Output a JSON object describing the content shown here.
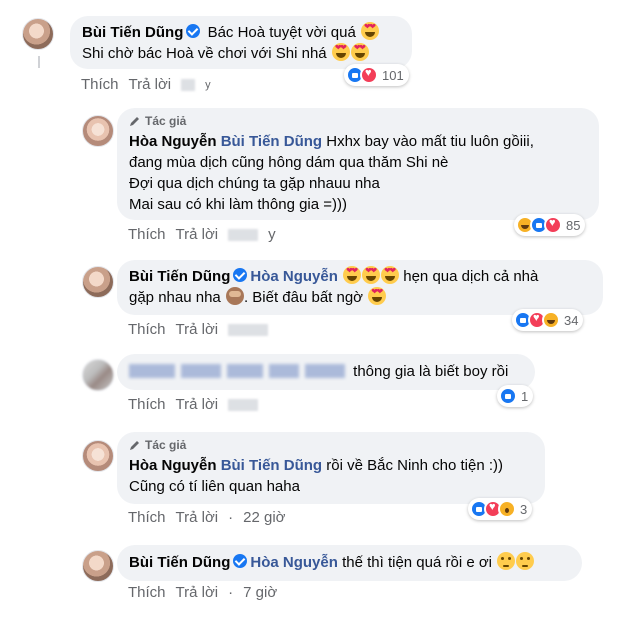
{
  "comments": [
    {
      "author": "Bùi Tiến Dũng",
      "lines": [
        "Bác Hoà tuyệt vời quá",
        "Shi chờ bác Hoà về chơi với Shi nhá"
      ],
      "actions": {
        "like": "Thích",
        "reply": "Trả lời",
        "time": "y"
      },
      "reactions": {
        "icons": [
          "like",
          "love"
        ],
        "count": "101"
      }
    },
    {
      "author_tag": "Tác giả",
      "author": "Hòa Nguyễn",
      "mention": "Bùi Tiến Dũng",
      "lines": [
        "Hxhx bay vào mất tiu luôn gồiii,",
        "đang mùa dịch cũng hông dám qua thăm Shi nè",
        "Đợi qua dịch chúng ta gặp nhauu nha",
        "Mai sau có khi làm thông gia =)))"
      ],
      "actions": {
        "like": "Thích",
        "reply": "Trả lời",
        "time": "y"
      },
      "reactions": {
        "icons": [
          "haha",
          "like",
          "love"
        ],
        "count": "85"
      }
    },
    {
      "author": "Bùi Tiến Dũng",
      "mention": "Hòa Nguyễn",
      "lines": [
        "hẹn qua dịch cả nhà",
        "gặp nhau nha",
        ". Biết đâu bất ngờ"
      ],
      "actions": {
        "like": "Thích",
        "reply": "Trả lời"
      },
      "reactions": {
        "icons": [
          "like",
          "love",
          "haha"
        ],
        "count": "34"
      }
    },
    {
      "text": "thông gia là biết boy rồi",
      "actions": {
        "like": "Thích",
        "reply": "Trả lời"
      },
      "reactions": {
        "icons": [
          "like"
        ],
        "count": "1"
      }
    },
    {
      "author_tag": "Tác giả",
      "author": "Hòa Nguyễn",
      "mention": "Bùi Tiến Dũng",
      "lines": [
        "rồi về Bắc Ninh cho tiện :))",
        "Cũng có tí liên quan haha"
      ],
      "actions": {
        "like": "Thích",
        "reply": "Trả lời",
        "time": "22 giờ"
      },
      "reactions": {
        "icons": [
          "like",
          "love",
          "wow"
        ],
        "count": "3"
      }
    },
    {
      "author": "Bùi Tiến Dũng",
      "mention": "Hòa Nguyễn",
      "text": "thế thì tiện quá rồi e ơi",
      "actions": {
        "like": "Thích",
        "reply": "Trả lời",
        "time": "7 giờ"
      }
    }
  ]
}
